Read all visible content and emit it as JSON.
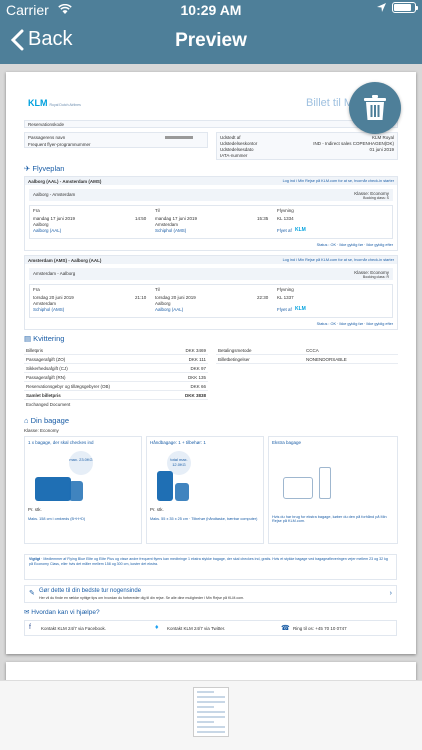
{
  "status": {
    "carrier": "Carrier",
    "time": "10:29 AM"
  },
  "nav": {
    "back_label": "Back",
    "title": "Preview"
  },
  "ticket": {
    "brand": "KLM",
    "brand_sub": "Royal Dutch Airlines",
    "title": "Billet til Mi",
    "ref_label": "Reservationskode",
    "ref_right": "Billetnum",
    "passenger_label": "Passagerens navn",
    "ff_label": "Frequent flyer-programnummer",
    "issued_label": "Udstedt af",
    "issued_value": "KLM Royal",
    "office_label": "Udstedelseskontor",
    "office_value": "IND - Indirect sales COPENHAGEN(DK)",
    "date_label": "Udstedelsesdato",
    "date_value": "01 juni 2019",
    "iata_label": "IATA-nummer",
    "flights_title": "Flyveplan",
    "flights_note": "Log ind i Min Rejse på KLM.com for at se, hvornår check-in starter",
    "flights": [
      {
        "route": "Aalborg (AAL) - Amsterdam (AMS)",
        "subroute": "Aalborg - Amsterdam",
        "class": "Klasse: Economy",
        "booking": "Booking class: S",
        "from_label": "Fra",
        "to_label": "Til",
        "flight_label": "Flyvning",
        "from_date": "mandag 17 juni 2019",
        "from_time": "14:50",
        "from_city": "Aalborg",
        "from_airport": "Aalborg (AAL)",
        "to_date": "mandag 17 juni 2019",
        "to_time": "15:35",
        "to_city": "Amsterdam",
        "to_airport": "Schiphol (AMS)",
        "flight_no": "KL 1334",
        "operated": "Flyet af",
        "status": "Status : OK · Ikke gyldig før · Ikke gyldig efter"
      },
      {
        "route": "Amsterdam (AMS) - Aalborg (AAL)",
        "subroute": "Amsterdam - Aalborg",
        "class": "Klasse: Economy",
        "booking": "Booking class: R",
        "from_label": "Fra",
        "to_label": "Til",
        "flight_label": "Flyvning",
        "from_date": "torsdag 20 juni 2019",
        "from_time": "21:10",
        "from_city": "Amsterdam",
        "from_airport": "Schiphol (AMS)",
        "to_date": "torsdag 20 juni 2019",
        "to_time": "22:30",
        "to_city": "Aalborg",
        "to_airport": "Aalborg (AAL)",
        "flight_no": "KL 1337",
        "operated": "Flyet af",
        "status": "Status : OK · Ikke gyldig før · Ikke gyldig efter"
      }
    ],
    "receipt_title": "Kvittering",
    "receipt_rows": [
      {
        "label": "Billetpris",
        "value": "DKK 3469"
      },
      {
        "label": "Passagerafgift (ZO)",
        "value": "DKK 111"
      },
      {
        "label": "Sikkerhedsafgift (CJ)",
        "value": "DKK 97"
      },
      {
        "label": "Passagerafgift (RN)",
        "value": "DKK 135"
      },
      {
        "label": "Reservationsgebyr og tillægsgebyrer (OB)",
        "value": "DKK 66"
      },
      {
        "label": "Samlet billetpris",
        "value": "DKK 3838"
      },
      {
        "label": "Exchanged Document",
        "value": ""
      }
    ],
    "pay_label": "Betalingsmetode",
    "pay_value": "CCCA",
    "terms_label": "Billetbetingelser",
    "terms_value": "NONENDORSABLE",
    "bag_title": "Din bagage",
    "bag_class": "Klasse: Economy",
    "bag1_title": "1 x bagage, der skal checkes ind",
    "bag1_weight": "max. 23.0KG",
    "bag1_note": "Maks. 158 cm i omkreds (B+H+D)",
    "bag2_title": "Håndbagage: 1 + tilbehør: 1",
    "bag2_weight": "total max. 12.0KG",
    "bag2_note": "Maks. 55 x 35 x 25 cm · Tilbehør (håndtaske, bærbar computer)",
    "bag3_title": "Ekstra bagage",
    "bag3_note": "Hvis du har brug for ekstra bagage, køber du den på forhånd på Min Rejse på KLM.com.",
    "per_label": "Pr. stk.",
    "tip_label": "Vigtigt",
    "tip_text": "Medlemmer af Flying Blue Elite og Elite Plus og visse andre frequent flyers kan medbringe 1 ekstra stykke bagage, der skal checkes ind, gratis. Hvis et stykke bagage ved bagageafleveringen vejer mellem 23 og 32 kg på Economy Class, eller hvis det måler mellem 158 og 300 cm, koster det ekstra.",
    "tips_title": "Gør dette til din bedste tur nogensinde",
    "tips_text": "Her vil du finde en række nyttige tips om hvordan du forbereder dig til din rejse. Se alle dine muligheder i Min Rejse på KLM.com.",
    "help_title": "Hvordan kan vi hjælpe?",
    "help_fb": "Kontakt KLM 24/7 via Facebook.",
    "help_tw": "Kontakt KLM 24/7 via Twitter.",
    "help_phone": "Ring til os: +45 70 10 0747"
  },
  "colors": {
    "bar": "#4e7f99",
    "klm": "#00a1de",
    "link": "#1a5da6"
  }
}
